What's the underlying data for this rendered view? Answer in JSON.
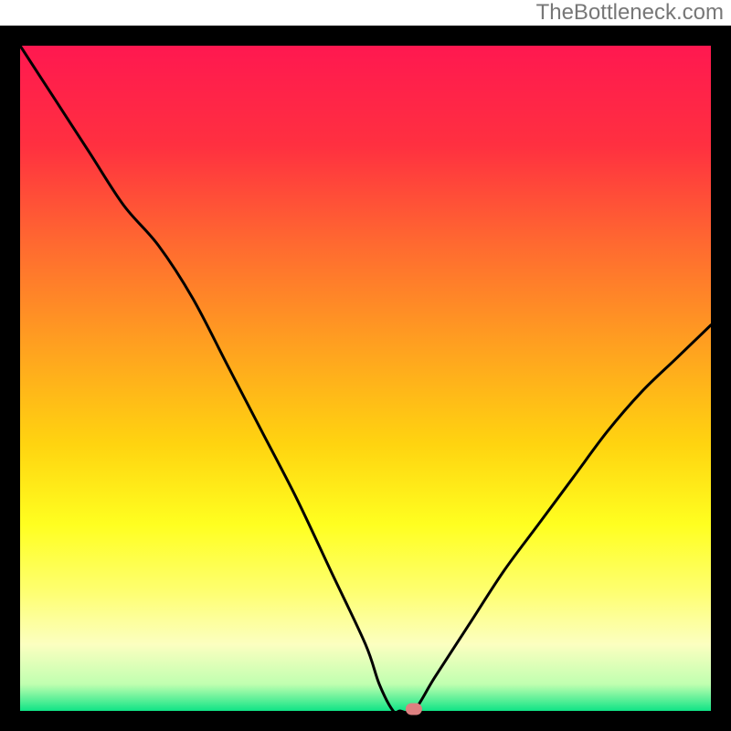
{
  "watermark": "TheBottleneck.com",
  "chart_data": {
    "type": "line",
    "title": "",
    "xlabel": "",
    "ylabel": "",
    "xlim": [
      0,
      100
    ],
    "ylim": [
      0,
      100
    ],
    "x": [
      0,
      5,
      10,
      15,
      20,
      25,
      30,
      35,
      40,
      45,
      50,
      52,
      54,
      55,
      57,
      60,
      65,
      70,
      75,
      80,
      85,
      90,
      95,
      100
    ],
    "values": [
      100,
      92,
      84,
      76,
      70,
      62,
      52,
      42,
      32,
      21,
      10,
      4,
      0,
      0,
      0,
      5,
      13,
      21,
      28,
      35,
      42,
      48,
      53,
      58
    ],
    "marker": {
      "x": 57,
      "y": 0
    },
    "frame": true,
    "gradient_stops": [
      {
        "offset": 0.0,
        "color": "#ff1850"
      },
      {
        "offset": 0.15,
        "color": "#ff3040"
      },
      {
        "offset": 0.3,
        "color": "#ff6a30"
      },
      {
        "offset": 0.45,
        "color": "#ffa020"
      },
      {
        "offset": 0.6,
        "color": "#ffd410"
      },
      {
        "offset": 0.72,
        "color": "#ffff20"
      },
      {
        "offset": 0.82,
        "color": "#feff70"
      },
      {
        "offset": 0.9,
        "color": "#fcffc0"
      },
      {
        "offset": 0.96,
        "color": "#c0ffb0"
      },
      {
        "offset": 1.0,
        "color": "#10e486"
      }
    ],
    "frame_color": "#000000",
    "frame_width": 22,
    "curve_color": "#000000",
    "curve_width": 3,
    "marker_color": "#dd8080"
  }
}
